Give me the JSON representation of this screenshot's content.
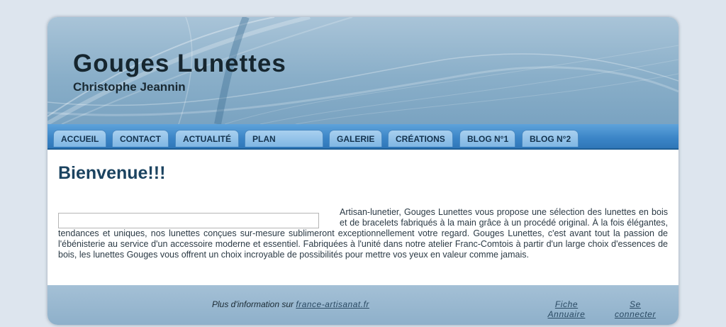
{
  "header": {
    "title": "Gouges Lunettes",
    "subtitle": "Christophe Jeannin"
  },
  "nav": {
    "items": [
      {
        "label": "ACCUEIL"
      },
      {
        "label": "CONTACT"
      },
      {
        "label": "ACTUALITÉ"
      },
      {
        "label": "PLAN"
      },
      {
        "label": "GALERIE"
      },
      {
        "label": "CRÉATIONS"
      },
      {
        "label": "BLOG N°1"
      },
      {
        "label": "BLOG N°2"
      }
    ]
  },
  "main": {
    "heading": "Bienvenue!!!",
    "intro": "Artisan-lunetier, Gouges Lunettes vous propose une sélection des lunettes en bois et de bracelets fabriqués à la main grâce à un procédé original. À la fois élégantes, tendances et uniques, nos lunettes conçues sur-mesure sublimeront exceptionnellement votre regard. Gouges Lunettes, c'est avant tout la passion de l'ébénisterie au service d'un accessoire moderne et essentiel. Fabriquées à l'unité dans notre atelier Franc-Comtois à partir d'un large choix d'essences de bois, les lunettes Gouges vous offrent un choix incroyable de possibilités pour mettre vos yeux en valeur comme jamais."
  },
  "footer": {
    "info_prefix": "Plus d'information sur",
    "info_link": "france-artisanat.fr",
    "annuaire_line1": "Fiche",
    "annuaire_line2": "Annuaire",
    "connect_line1": "Se",
    "connect_line2": "connecter"
  },
  "colors": {
    "nav_bar": "#3a84c6",
    "tab": "#8fc0e8",
    "heading": "#1b4360",
    "footer": "#97b6cf"
  }
}
